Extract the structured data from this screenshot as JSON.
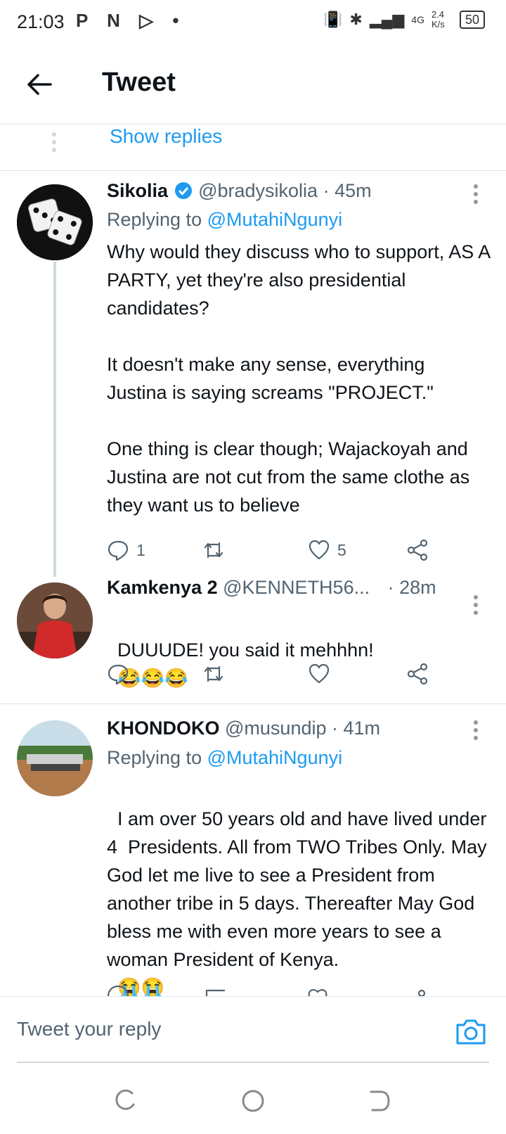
{
  "status_bar": {
    "time": "21:03",
    "left_icons": "P N ▷ •",
    "network": "4G",
    "speed": "2.4 K/s",
    "battery": "50"
  },
  "header": {
    "title": "Tweet"
  },
  "show_replies": {
    "label": "Show replies"
  },
  "tweets": [
    {
      "name": "Sikolia",
      "verified": true,
      "handle": "@bradysikolia",
      "time": "· 45m",
      "replying_prefix": "Replying to",
      "replying_to": "@MutahiNgunyi",
      "text": "Why would they discuss who to support, AS A PARTY, yet they're also presidential candidates?\n\nIt doesn't make any sense, everything Justina is saying screams \"PROJECT.\"\n\nOne thing is clear though; Wajackoyah and Justina are not cut from the same clothe as they want us to believe",
      "replies": "1",
      "retweets": "",
      "likes": "5"
    },
    {
      "name": "Kamkenya 2",
      "handle": "@KENNETH56...",
      "time": "· 28m",
      "text": "DUUUDE! you said it mehhhn!",
      "emoji": "😂😂😂",
      "replies": "",
      "retweets": "",
      "likes": ""
    },
    {
      "name": "KHONDOKO",
      "handle": "@musundip",
      "time": "· 41m",
      "replying_prefix": "Replying to",
      "replying_to": "@MutahiNgunyi",
      "text": "I am over 50 years old and have lived under 4  Presidents. All from TWO Tribes Only. May God let me live to see a President from another tribe in 5 days. Thereafter May God bless me with even more years to see a woman President of Kenya.",
      "emoji": "😭😭"
    }
  ],
  "reply_bar": {
    "placeholder": "Tweet your reply"
  },
  "colors": {
    "accent": "#1d9bf0",
    "secondary_text": "#536471",
    "divider": "#e1e6ea"
  }
}
